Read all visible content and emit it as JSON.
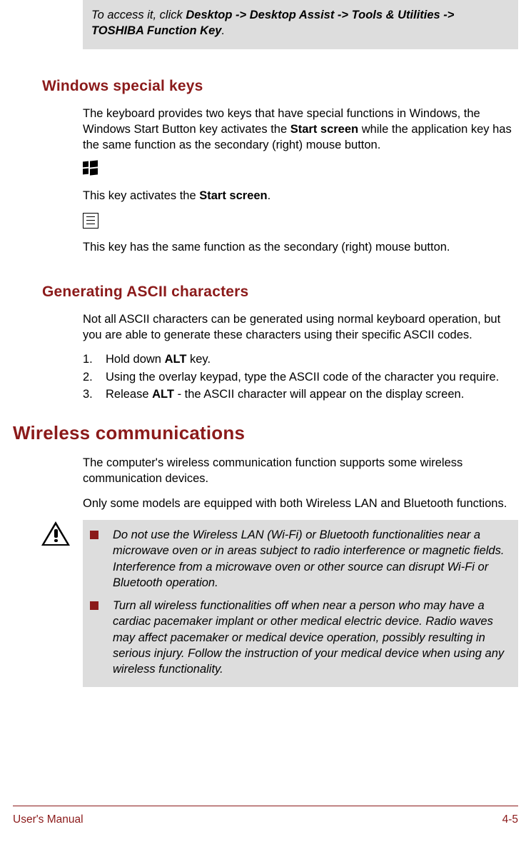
{
  "note": {
    "prefix": "To access it, click ",
    "path": "Desktop -> Desktop Assist -> Tools & Utilities -> TOSHIBA Function Key",
    "suffix": "."
  },
  "section1": {
    "heading": "Windows special keys",
    "intro_part1": "The keyboard provides two keys that have special functions in Windows, the Windows Start Button key activates the ",
    "intro_bold1": "Start screen",
    "intro_part2": " while the application key has the same function as the secondary (right) mouse button.",
    "winkey_text1": "This key activates the ",
    "winkey_bold": "Start screen",
    "winkey_text2": ".",
    "menukey_text": "This key has the same function as the secondary (right) mouse button."
  },
  "section2": {
    "heading": "Generating ASCII characters",
    "intro": "Not all ASCII characters can be generated using normal keyboard operation, but you are able to generate these characters using their specific ASCII codes.",
    "list": [
      {
        "num": "1.",
        "before": "Hold down ",
        "bold": "ALT",
        "after": " key."
      },
      {
        "num": "2.",
        "before": "Using the overlay keypad, type the ASCII code of the character you require.",
        "bold": "",
        "after": ""
      },
      {
        "num": "3.",
        "before": "Release ",
        "bold": "ALT",
        "after": " - the ASCII character will appear on the display screen."
      }
    ]
  },
  "section3": {
    "heading": "Wireless communications",
    "p1": "The computer's wireless communication function supports some wireless communication devices.",
    "p2": "Only some models are equipped with both Wireless LAN and Bluetooth functions.",
    "warnings": [
      "Do not use the Wireless LAN (Wi-Fi) or Bluetooth functionalities near a microwave oven or in areas subject to radio interference or magnetic fields. Interference from a microwave oven or other source can disrupt Wi-Fi or Bluetooth operation.",
      "Turn all wireless functionalities off when near a person who may have a cardiac pacemaker implant or other medical electric device. Radio waves may affect pacemaker or medical device operation, possibly resulting in serious injury. Follow the instruction of your medical device when using any wireless functionality."
    ]
  },
  "footer": {
    "left": "User's Manual",
    "right": "4-5"
  }
}
